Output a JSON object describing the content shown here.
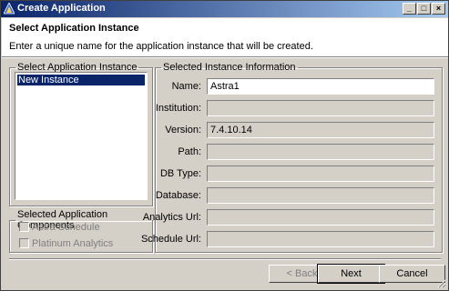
{
  "window": {
    "title": "Create Application",
    "minimize_glyph": "_",
    "maximize_glyph": "□",
    "close_glyph": "×"
  },
  "header": {
    "title": "Select Application Instance",
    "description": "Enter a unique name for the application instance that will be created."
  },
  "instances": {
    "legend": "Select Application Instance",
    "items": [
      "New Instance"
    ]
  },
  "components": {
    "legend": "Selected Application Components",
    "items": [
      {
        "label": "Astra Schedule",
        "checked": false
      },
      {
        "label": "Platinum Analytics",
        "checked": false
      }
    ]
  },
  "info": {
    "legend": "Selected Instance Information",
    "fields": [
      {
        "label": "Name:",
        "value": "Astra1"
      },
      {
        "label": "Institution:",
        "value": ""
      },
      {
        "label": "Version:",
        "value": "7.4.10.14"
      },
      {
        "label": "Path:",
        "value": ""
      },
      {
        "label": "DB Type:",
        "value": ""
      },
      {
        "label": "Database:",
        "value": ""
      },
      {
        "label": "Analytics Url:",
        "value": ""
      },
      {
        "label": "Schedule Url:",
        "value": ""
      }
    ]
  },
  "buttons": {
    "back": "< Back",
    "next": "Next",
    "cancel": "Cancel"
  }
}
